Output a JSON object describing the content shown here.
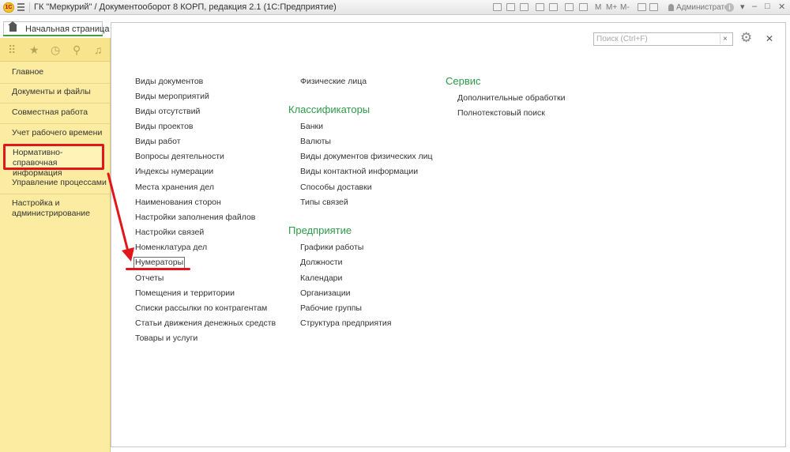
{
  "window": {
    "title": "ГК \"Меркурий\" / Документооборот 8 КОРП, редакция 2.1  (1С:Предприятие)",
    "logo_text": "1С",
    "user": "Администратор",
    "font_buttons": [
      "M",
      "M+",
      "M-"
    ],
    "controls": [
      "▾",
      "–",
      "□",
      "✕"
    ]
  },
  "tab": {
    "label": "Начальная страница",
    "icon": "home-icon"
  },
  "sidebar": {
    "tools": [
      "apps-grid-icon",
      "star-icon",
      "history-icon",
      "search-icon",
      "bell-icon"
    ],
    "items": [
      "Главное",
      "Документы и файлы",
      "Совместная работа",
      "Учет рабочего времени",
      "Нормативно-справочная информация",
      "Управление процессами",
      "Настройка и администрирование"
    ],
    "active_index": 4
  },
  "search": {
    "placeholder": "Поиск (Ctrl+F)",
    "value": "",
    "clear_label": "×"
  },
  "content": {
    "col1": [
      "Виды документов",
      "Виды мероприятий",
      "Виды отсутствий",
      "Виды проектов",
      "Виды работ",
      "Вопросы деятельности",
      "Индексы нумерации",
      "Места хранения дел",
      "Наименования сторон",
      "Настройки заполнения файлов",
      "Настройки связей",
      "Номенклатура дел",
      "Нумераторы",
      "Отчеты",
      "Помещения и территории",
      "Списки рассылки по контрагентам",
      "Статьи движения денежных средств",
      "Товары и услуги"
    ],
    "col2_top": [
      "Физические лица"
    ],
    "classifiers": {
      "title": "Классификаторы",
      "items": [
        "Банки",
        "Валюты",
        "Виды документов физических лиц",
        "Виды контактной информации",
        "Способы доставки",
        "Типы связей"
      ]
    },
    "enterprise": {
      "title": "Предприятие",
      "items": [
        "Графики работы",
        "Должности",
        "Календари",
        "Организации",
        "Рабочие группы",
        "Структура предприятия"
      ]
    },
    "service": {
      "title": "Сервис",
      "items": [
        "Дополнительные обработки",
        "Полнотекстовый поиск"
      ]
    },
    "focused_item": "Нумераторы"
  },
  "colors": {
    "accent_green": "#2d9a4a",
    "sidebar_bg": "#fbeca1",
    "annotation_red": "#e0161a"
  }
}
